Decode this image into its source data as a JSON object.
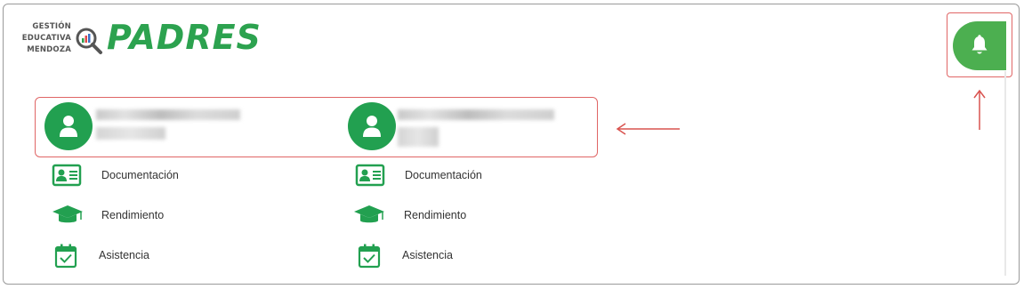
{
  "logo": {
    "line1": "GESTIÓN",
    "line2": "EDUCATIVA",
    "line3": "MENDOZA",
    "brand": "PADRES"
  },
  "notifications": {
    "icon": "bell-icon"
  },
  "students": [
    {
      "menu": [
        {
          "icon": "id-card-icon",
          "label": "Documentación"
        },
        {
          "icon": "graduation-cap-icon",
          "label": "Rendimiento"
        },
        {
          "icon": "calendar-check-icon",
          "label": "Asistencia"
        }
      ]
    },
    {
      "menu": [
        {
          "icon": "id-card-icon",
          "label": "Documentación"
        },
        {
          "icon": "graduation-cap-icon",
          "label": "Rendimiento"
        },
        {
          "icon": "calendar-check-icon",
          "label": "Asistencia"
        }
      ]
    }
  ],
  "colors": {
    "brand_green": "#2ca24f",
    "avatar_green": "#22a050",
    "bell_green": "#4caf50",
    "highlight_red": "#e06666"
  }
}
